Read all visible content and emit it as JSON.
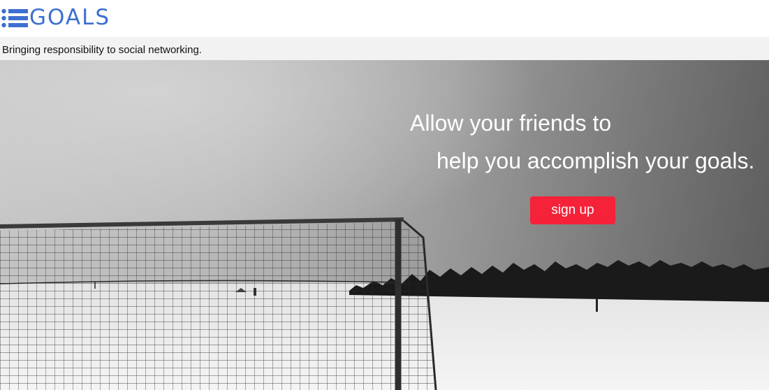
{
  "header": {
    "logo_text": "GOALS",
    "logo_icon": "list-icon",
    "brand_color": "#3d6fd1"
  },
  "tagline": "Bringing responsibility to social networking.",
  "hero": {
    "headline_line1": "Allow your friends to",
    "headline_line2": "help you accomplish your goals.",
    "signup_label": "sign up",
    "button_color": "#f52239",
    "image": "snowy-field-soccer-goal-photo"
  }
}
